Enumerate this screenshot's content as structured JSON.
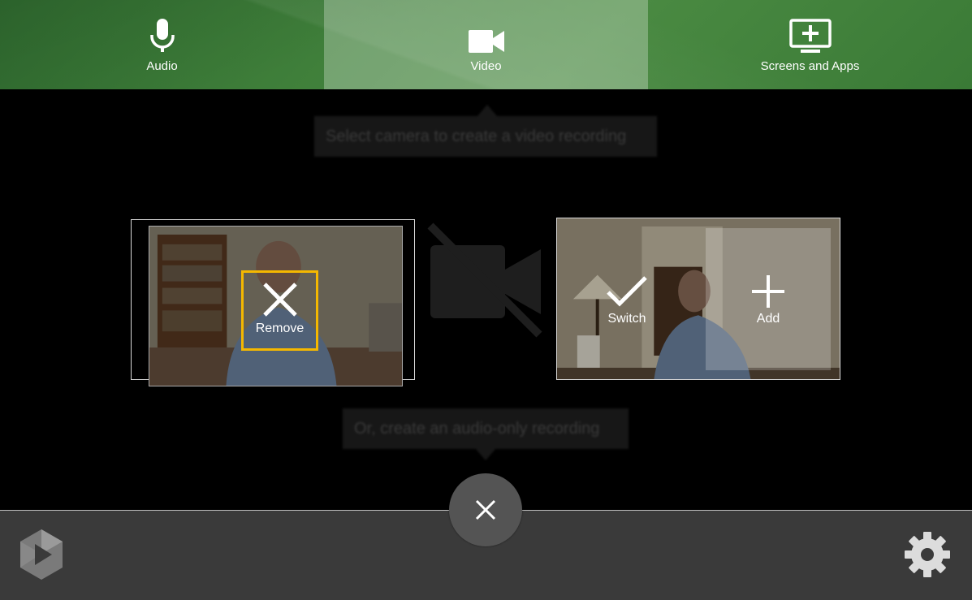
{
  "tabs": [
    {
      "label": "Audio",
      "icon": "microphone-icon",
      "active": false
    },
    {
      "label": "Video",
      "icon": "video-camera-icon",
      "active": true
    },
    {
      "label": "Screens and Apps",
      "icon": "monitor-add-icon",
      "active": false
    }
  ],
  "hints": {
    "top": "Select camera to create a video recording",
    "bottom": "Or, create an audio-only recording"
  },
  "cameras": {
    "left": {
      "action_label": "Remove",
      "action_icon": "close-icon"
    },
    "right": {
      "switch_label": "Switch",
      "switch_icon": "checkmark-icon",
      "add_label": "Add",
      "add_icon": "plus-icon"
    }
  },
  "colors": {
    "tab_bar": "#3f7f3a",
    "focus_outline": "#f5b800",
    "bottom_bar": "#3a3a3a"
  }
}
